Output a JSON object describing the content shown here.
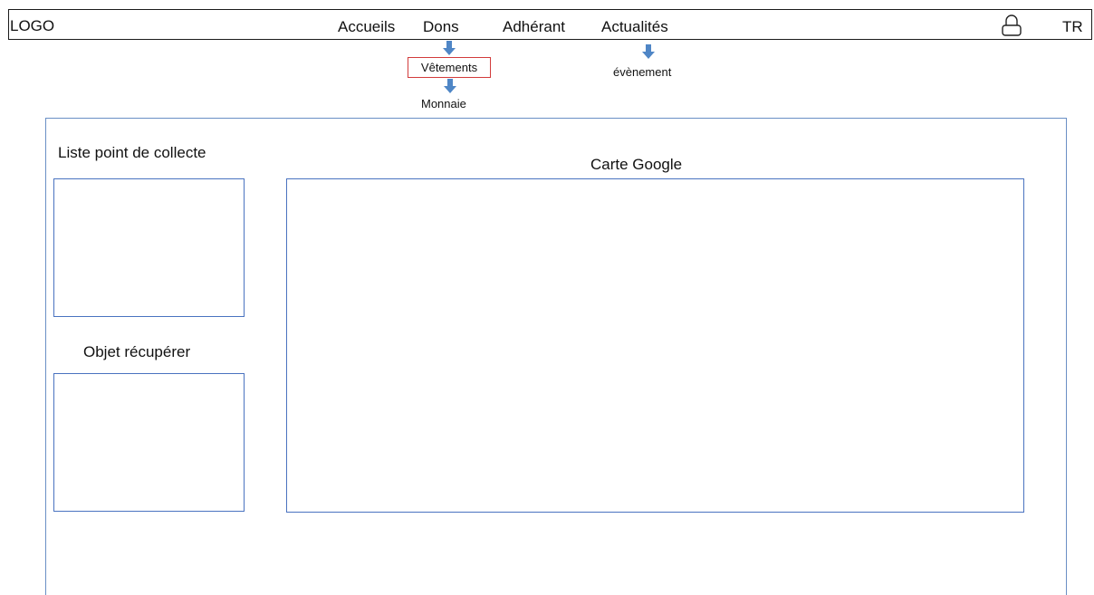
{
  "header": {
    "logo_text": "LOGO",
    "nav": {
      "accueils": "Accueils",
      "dons": "Dons",
      "adherant": "Adhérant",
      "actualites": "Actualités"
    },
    "language": "TR",
    "user_icon": "user-icon"
  },
  "dropdowns": {
    "dons": [
      "Vêtements",
      "Monnaie"
    ],
    "actualites": [
      "évènement"
    ]
  },
  "main": {
    "collect_points_title": "Liste point de collecte",
    "recovered_items_title": "Objet récupérer",
    "map_title": "Carte Google"
  },
  "colors": {
    "frame_border": "#6a8fc5",
    "box_border": "#4a73c0",
    "arrow": "#4f86c6",
    "highlight": "#d23b3b"
  }
}
